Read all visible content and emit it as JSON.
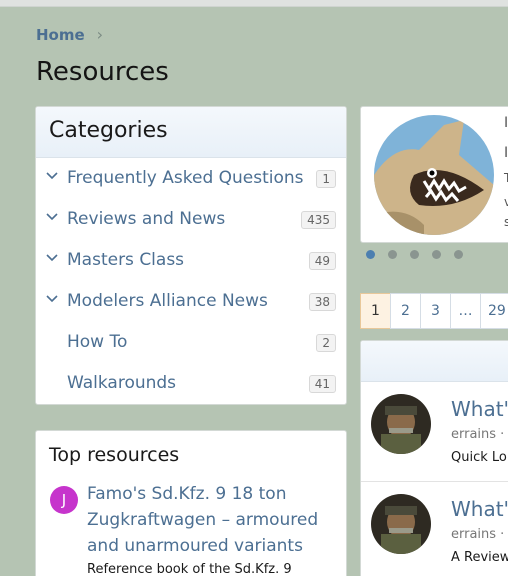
{
  "breadcrumb": {
    "home": "Home"
  },
  "page": {
    "title": "Resources"
  },
  "categories": {
    "title": "Categories",
    "items": [
      {
        "label": "Frequently Asked Questions",
        "count": "1",
        "expandable": true
      },
      {
        "label": "Reviews and News",
        "count": "435",
        "expandable": true
      },
      {
        "label": "Masters Class",
        "count": "49",
        "expandable": true
      },
      {
        "label": "Modelers Alliance News",
        "count": "38",
        "expandable": true
      },
      {
        "label": "How To",
        "count": "2",
        "expandable": false
      },
      {
        "label": "Walkarounds",
        "count": "41",
        "expandable": false
      }
    ]
  },
  "top_resources": {
    "title": "Top resources",
    "avatar_letter": "J",
    "avatar_color": "#c634cc",
    "item_title": "Famo's Sd.Kfz. 9 18 ton Zugkraftwagen – armoured and unarmoured variants",
    "item_desc": "Reference book of the Sd.Kfz. 9"
  },
  "featured": {
    "text_lines": [
      "I",
      "I",
      "T",
      "v",
      "s"
    ],
    "dots": 5,
    "active_dot": 0
  },
  "pagination": {
    "pages": [
      "1",
      "2",
      "3",
      "…",
      "29"
    ],
    "current": "1"
  },
  "resource_list": {
    "items": [
      {
        "title": "What's",
        "meta": "errains ·",
        "desc": "Quick Lo"
      },
      {
        "title": "What's",
        "meta": "errains ·",
        "desc": "A Review"
      }
    ]
  },
  "colors": {
    "background": "#b5c4b3",
    "link": "#4c6f92",
    "accent": "#4c7fb0"
  }
}
